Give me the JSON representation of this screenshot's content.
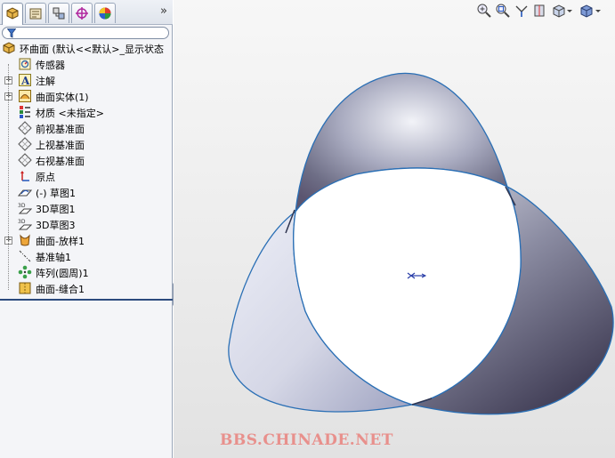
{
  "tabs": [
    {
      "name": "featuremanager-tab",
      "active": true
    },
    {
      "name": "propertymanager-tab",
      "active": false
    },
    {
      "name": "configurationmanager-tab",
      "active": false
    },
    {
      "name": "dimxpert-tab",
      "active": false
    },
    {
      "name": "display-manager-tab",
      "active": false
    }
  ],
  "tab_expand": "»",
  "tree": {
    "root": "环曲面   (默认<<默认>_显示状态",
    "items": [
      {
        "label": "传感器",
        "icon": "sensor-icon",
        "expandable": false
      },
      {
        "label": "注解",
        "icon": "annotations-icon",
        "expandable": true
      },
      {
        "label": "曲面实体(1)",
        "icon": "surface-bodies-icon",
        "expandable": true
      },
      {
        "label": "材质 <未指定>",
        "icon": "material-icon",
        "expandable": false
      },
      {
        "label": "前视基准面",
        "icon": "plane-icon",
        "expandable": false
      },
      {
        "label": "上视基准面",
        "icon": "plane-icon",
        "expandable": false
      },
      {
        "label": "右视基准面",
        "icon": "plane-icon",
        "expandable": false
      },
      {
        "label": "原点",
        "icon": "origin-icon",
        "expandable": false
      },
      {
        "label": "(-) 草图1",
        "icon": "sketch-icon",
        "expandable": false
      },
      {
        "label": "3D草图1",
        "icon": "3d-sketch-icon",
        "expandable": false
      },
      {
        "label": "3D草图3",
        "icon": "3d-sketch-icon",
        "expandable": false
      },
      {
        "label": "曲面-放样1",
        "icon": "surface-loft-icon",
        "expandable": true
      },
      {
        "label": "基准轴1",
        "icon": "axis-icon",
        "expandable": false
      },
      {
        "label": "阵列(圆周)1",
        "icon": "circular-pattern-icon",
        "expandable": false
      },
      {
        "label": "曲面-缝合1",
        "icon": "surface-knit-icon",
        "expandable": false
      }
    ]
  },
  "watermark": "BBS.CHINADE.NET",
  "colors": {
    "surface_edge": "#2a6fb5",
    "surface_light": "#e4e6f0",
    "surface_dark": "#4a4a60",
    "watermark": "#e8908c"
  }
}
